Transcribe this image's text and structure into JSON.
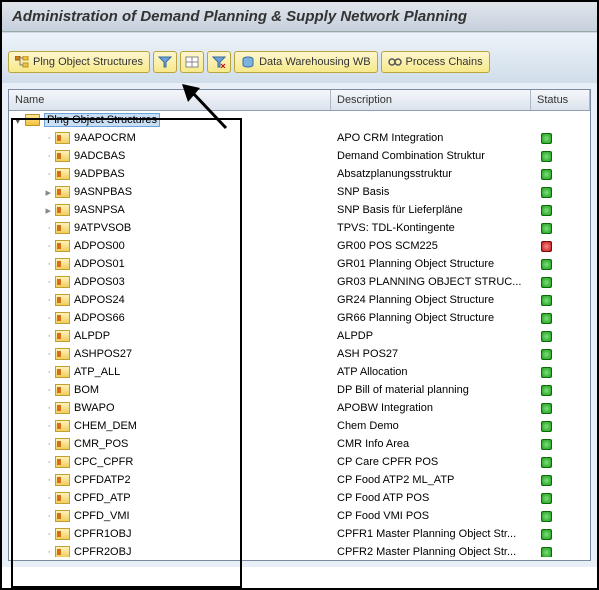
{
  "title": "Administration of Demand Planning & Supply Network Planning",
  "toolbar": {
    "plng_structures": "Plng Object Structures",
    "data_warehousing": "Data Warehousing WB",
    "process_chains": "Process Chains"
  },
  "columns": {
    "name": "Name",
    "description": "Description",
    "status": "Status"
  },
  "root": {
    "label": "Plng Object Structures"
  },
  "rows": [
    {
      "code": "9AAPOCRM",
      "desc": "APO CRM Integration",
      "status": "green",
      "expandable": false
    },
    {
      "code": "9ADCBAS",
      "desc": "Demand Combination Struktur",
      "status": "green",
      "expandable": false
    },
    {
      "code": "9ADPBAS",
      "desc": "Absatzplanungsstruktur",
      "status": "green",
      "expandable": false
    },
    {
      "code": "9ASNPBAS",
      "desc": "SNP Basis",
      "status": "green",
      "expandable": true
    },
    {
      "code": "9ASNPSA",
      "desc": "SNP Basis für Lieferpläne",
      "status": "green",
      "expandable": true
    },
    {
      "code": "9ATPVSOB",
      "desc": "TPVS: TDL-Kontingente",
      "status": "green",
      "expandable": false
    },
    {
      "code": "ADPOS00",
      "desc": "GR00 POS SCM225",
      "status": "red",
      "expandable": false
    },
    {
      "code": "ADPOS01",
      "desc": "GR01 Planning Object Structure",
      "status": "green",
      "expandable": false
    },
    {
      "code": "ADPOS03",
      "desc": "GR03 PLANNING OBJECT STRUC...",
      "status": "green",
      "expandable": false
    },
    {
      "code": "ADPOS24",
      "desc": "GR24 Planning Object Structure",
      "status": "green",
      "expandable": false
    },
    {
      "code": "ADPOS66",
      "desc": "GR66 Planning Object Structure",
      "status": "green",
      "expandable": false
    },
    {
      "code": "ALPDP",
      "desc": "ALPDP",
      "status": "green",
      "expandable": false
    },
    {
      "code": "ASHPOS27",
      "desc": "ASH POS27",
      "status": "green",
      "expandable": false
    },
    {
      "code": "ATP_ALL",
      "desc": "ATP Allocation",
      "status": "green",
      "expandable": false
    },
    {
      "code": "BOM",
      "desc": "DP Bill of material planning",
      "status": "green",
      "expandable": false
    },
    {
      "code": "BWAPO",
      "desc": "APOBW Integration",
      "status": "green",
      "expandable": false
    },
    {
      "code": "CHEM_DEM",
      "desc": "Chem Demo",
      "status": "green",
      "expandable": false
    },
    {
      "code": "CMR_POS",
      "desc": "CMR Info Area",
      "status": "green",
      "expandable": false
    },
    {
      "code": "CPC_CPFR",
      "desc": "CP Care CPFR POS",
      "status": "green",
      "expandable": false
    },
    {
      "code": "CPFDATP2",
      "desc": "CP Food ATP2 ML_ATP",
      "status": "green",
      "expandable": false
    },
    {
      "code": "CPFD_ATP",
      "desc": "CP Food ATP POS",
      "status": "green",
      "expandable": false
    },
    {
      "code": "CPFD_VMI",
      "desc": "CP Food VMI POS",
      "status": "green",
      "expandable": false
    },
    {
      "code": "CPFR1OBJ",
      "desc": "CPFR1 Master Planning Object Str...",
      "status": "green",
      "expandable": false
    },
    {
      "code": "CPFR2OBJ",
      "desc": "CPFR2 Master Planning Object Str...",
      "status": "green",
      "expandable": false
    }
  ]
}
